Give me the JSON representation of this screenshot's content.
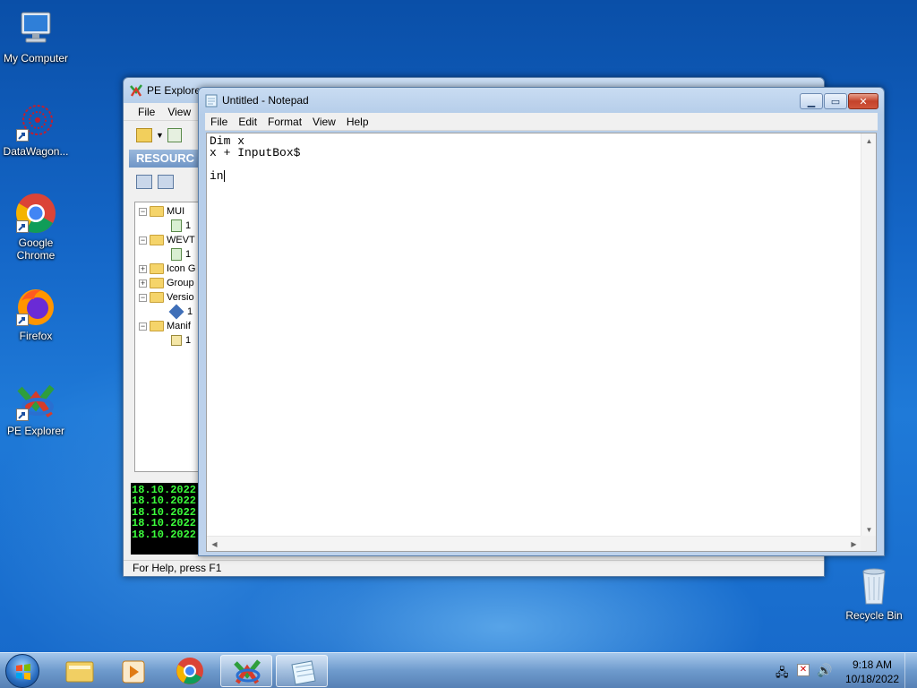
{
  "desktop": {
    "icons": [
      {
        "label": "My Computer"
      },
      {
        "label": "DataWagon..."
      },
      {
        "label": "Google Chrome"
      },
      {
        "label": "Firefox"
      },
      {
        "label": "PE Explorer"
      },
      {
        "label": "Recycle Bin"
      }
    ]
  },
  "pe_explorer": {
    "title": "PE Explorer",
    "menu": [
      "File",
      "View"
    ],
    "resource_header": "RESOURC",
    "tree": [
      "MUI",
      "1",
      "WEVT",
      "1",
      "Icon G",
      "Group",
      "Versio",
      "1",
      "Manif",
      "1"
    ],
    "console_lines": [
      "18.10.2022",
      "18.10.2022",
      "18.10.2022",
      "18.10.2022",
      "18.10.2022"
    ],
    "status": "For Help, press F1"
  },
  "notepad": {
    "title": "Untitled - Notepad",
    "menu": [
      "File",
      "Edit",
      "Format",
      "View",
      "Help"
    ],
    "lines": [
      "Dim x",
      "x + InputBox$",
      "",
      "in"
    ]
  },
  "taskbar": {
    "time": "9:18 AM",
    "date": "10/18/2022"
  }
}
